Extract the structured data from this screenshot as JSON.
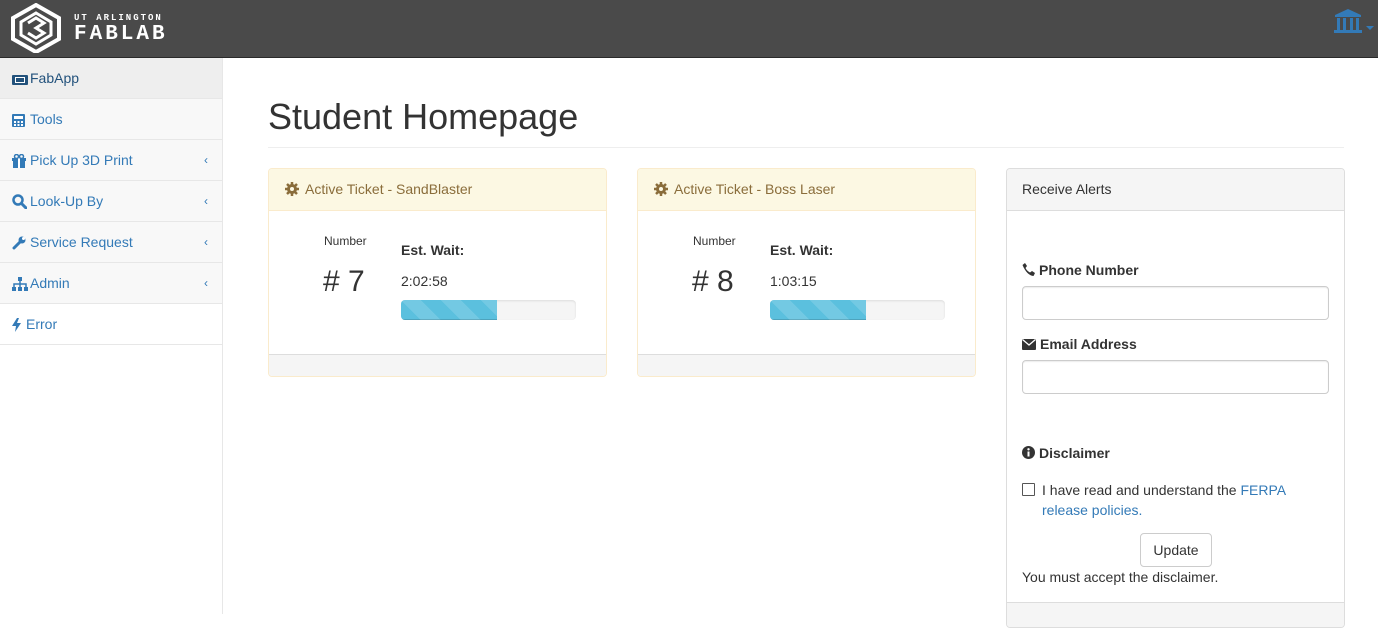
{
  "brand": {
    "line1": "UT ARLINGTON",
    "line2": "FABLAB"
  },
  "nav": {
    "account_icon": "bank-icon"
  },
  "sidebar": {
    "items": [
      {
        "label": "FabApp",
        "icon": "ticket-icon"
      },
      {
        "label": "Tools",
        "icon": "calculator-icon"
      },
      {
        "label": "Pick Up 3D Print",
        "icon": "gift-icon",
        "caret": "‹"
      },
      {
        "label": "Look-Up By",
        "icon": "search-icon",
        "caret": "‹"
      },
      {
        "label": "Service Request",
        "icon": "wrench-icon",
        "caret": "‹"
      },
      {
        "label": "Admin",
        "icon": "sitemap-icon",
        "caret": "‹"
      },
      {
        "label": "Error",
        "icon": "bolt-icon"
      }
    ]
  },
  "main": {
    "title": "Student Homepage"
  },
  "tickets": [
    {
      "title": "Active Ticket - SandBlaster",
      "number_label": "Number",
      "number": "# 7",
      "wait_label": "Est. Wait:",
      "wait_time": "2:02:58",
      "progress_pct": 55
    },
    {
      "title": "Active Ticket - Boss Laser",
      "number_label": "Number",
      "number": "# 8",
      "wait_label": "Est. Wait:",
      "wait_time": "1:03:15",
      "progress_pct": 55
    }
  ],
  "alerts": {
    "title": "Receive Alerts",
    "phone_label": "Phone Number",
    "phone_value": "",
    "email_label": "Email Address",
    "email_value": "",
    "disclaimer_label": "Disclaimer",
    "checkbox_text": "I have read and understand the",
    "checkbox_link": "FERPA release policies.",
    "update_label": "Update",
    "must_accept": "You must accept the disclaimer."
  },
  "colors": {
    "accent": "#337ab7",
    "warning_bg": "#fcf8e3",
    "progress": "#5bc0de",
    "navbar": "#4a4a4a"
  }
}
